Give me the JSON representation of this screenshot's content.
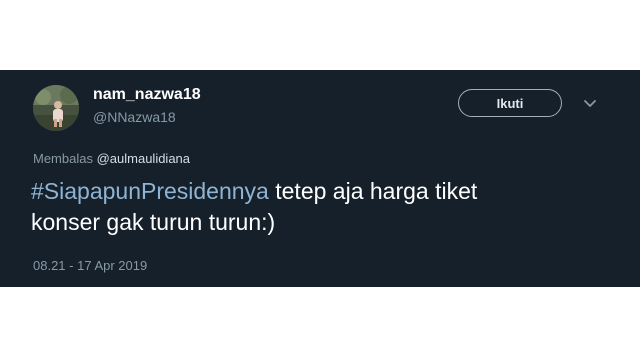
{
  "tweet": {
    "display_name": "nam_nazwa18",
    "handle": "@NNazwa18",
    "follow_label": "Ikuti",
    "more_icon": "chevron-down-icon",
    "reply_prefix": "Membalas",
    "reply_to": "@aulmaulidiana",
    "hashtag": "#SiapapunPresidennya",
    "text_line1_rest": " tetep aja harga tiket",
    "text_line2": "konser gak turun turun:)",
    "timestamp": "08.21 - 17 Apr 2019"
  },
  "colors": {
    "card_background": "#15202b",
    "secondary_text": "#8899a6",
    "hashtag": "#8fb4d3"
  }
}
